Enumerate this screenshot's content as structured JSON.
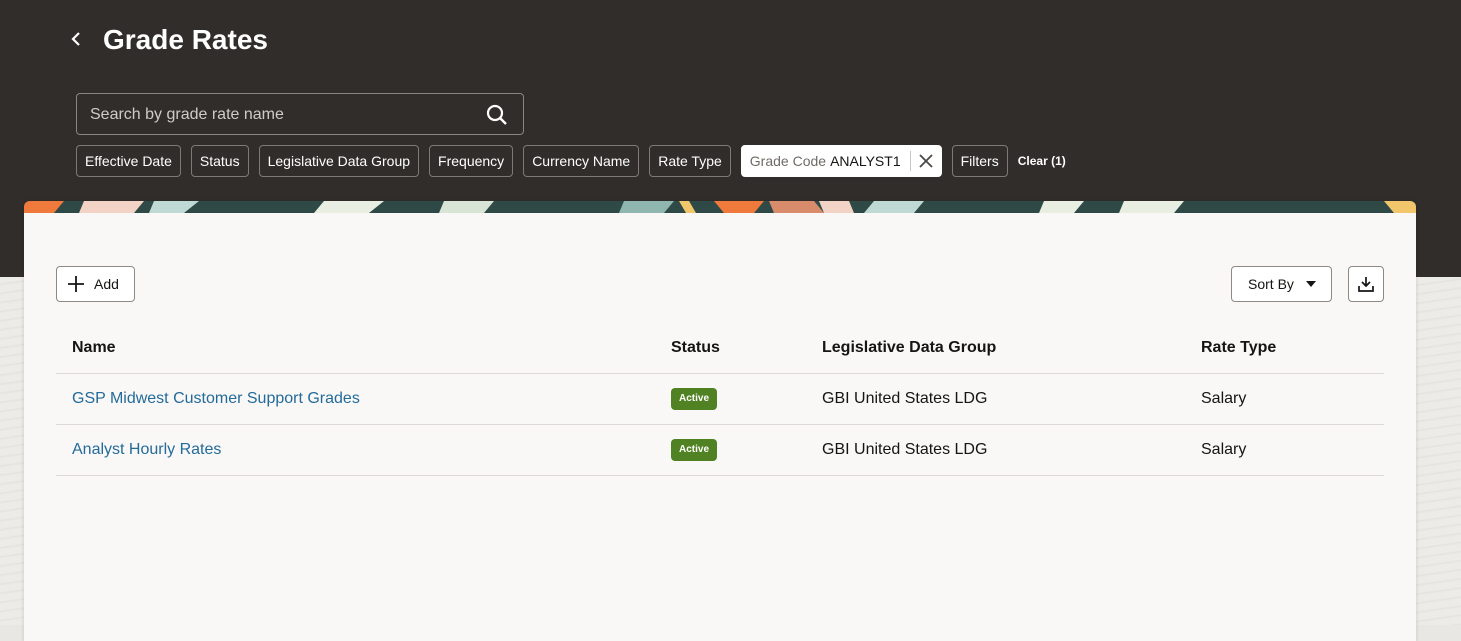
{
  "page": {
    "title": "Grade Rates"
  },
  "search": {
    "placeholder": "Search by grade rate name"
  },
  "filters": {
    "chips": [
      "Effective Date",
      "Status",
      "Legislative Data Group",
      "Frequency",
      "Currency Name",
      "Rate Type"
    ],
    "active_chip": {
      "label": "Grade Code",
      "value": "ANALYST1"
    },
    "filters_label": "Filters",
    "clear_label": "Clear (1)"
  },
  "toolbar": {
    "add_label": "Add",
    "sort_label": "Sort By"
  },
  "table": {
    "columns": [
      "Name",
      "Status",
      "Legislative Data Group",
      "Rate Type"
    ],
    "rows": [
      {
        "name": "GSP Midwest Customer Support Grades",
        "status": "Active",
        "ldg": "GBI United States LDG",
        "rate_type": "Salary"
      },
      {
        "name": "Analyst Hourly Rates",
        "status": "Active",
        "ldg": "GBI United States LDG",
        "rate_type": "Salary"
      }
    ]
  },
  "icons": [
    "back-chevron-icon",
    "search-icon",
    "close-icon",
    "plus-icon",
    "caret-down-icon",
    "download-icon"
  ],
  "colors": {
    "header_bg": "#312d2a",
    "link": "#236b9a",
    "status_active": "#508223",
    "card_bg": "#f9f8f6"
  }
}
